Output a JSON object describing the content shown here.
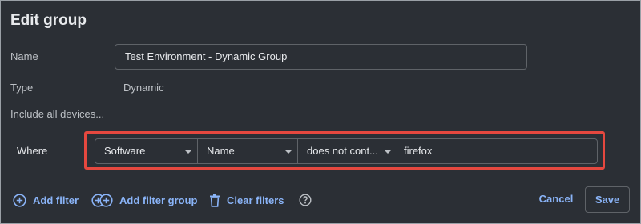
{
  "dialog": {
    "title": "Edit group"
  },
  "form": {
    "name_label": "Name",
    "name_value": "Test Environment - Dynamic Group",
    "type_label": "Type",
    "type_value": "Dynamic",
    "include_label": "Include all devices...",
    "where_label": "Where",
    "filter": {
      "category": "Software",
      "field": "Name",
      "operator": "does not cont...",
      "value": "firefox"
    }
  },
  "actions": {
    "add_filter": "Add filter",
    "add_filter_group": "Add filter group",
    "clear_filters": "Clear filters"
  },
  "footer": {
    "cancel": "Cancel",
    "save": "Save"
  },
  "icons": {
    "add_filter": "plus-circle-icon",
    "add_filter_group": "double-plus-circle-icon",
    "clear_filters": "trash-icon",
    "help": "help-circle-icon",
    "dropdown": "caret-down-icon"
  },
  "colors": {
    "background": "#2b2f35",
    "accent": "#8ab4f8",
    "highlight": "#e5483f",
    "text": "#e8eaed",
    "muted_text": "#bdc1c6"
  }
}
